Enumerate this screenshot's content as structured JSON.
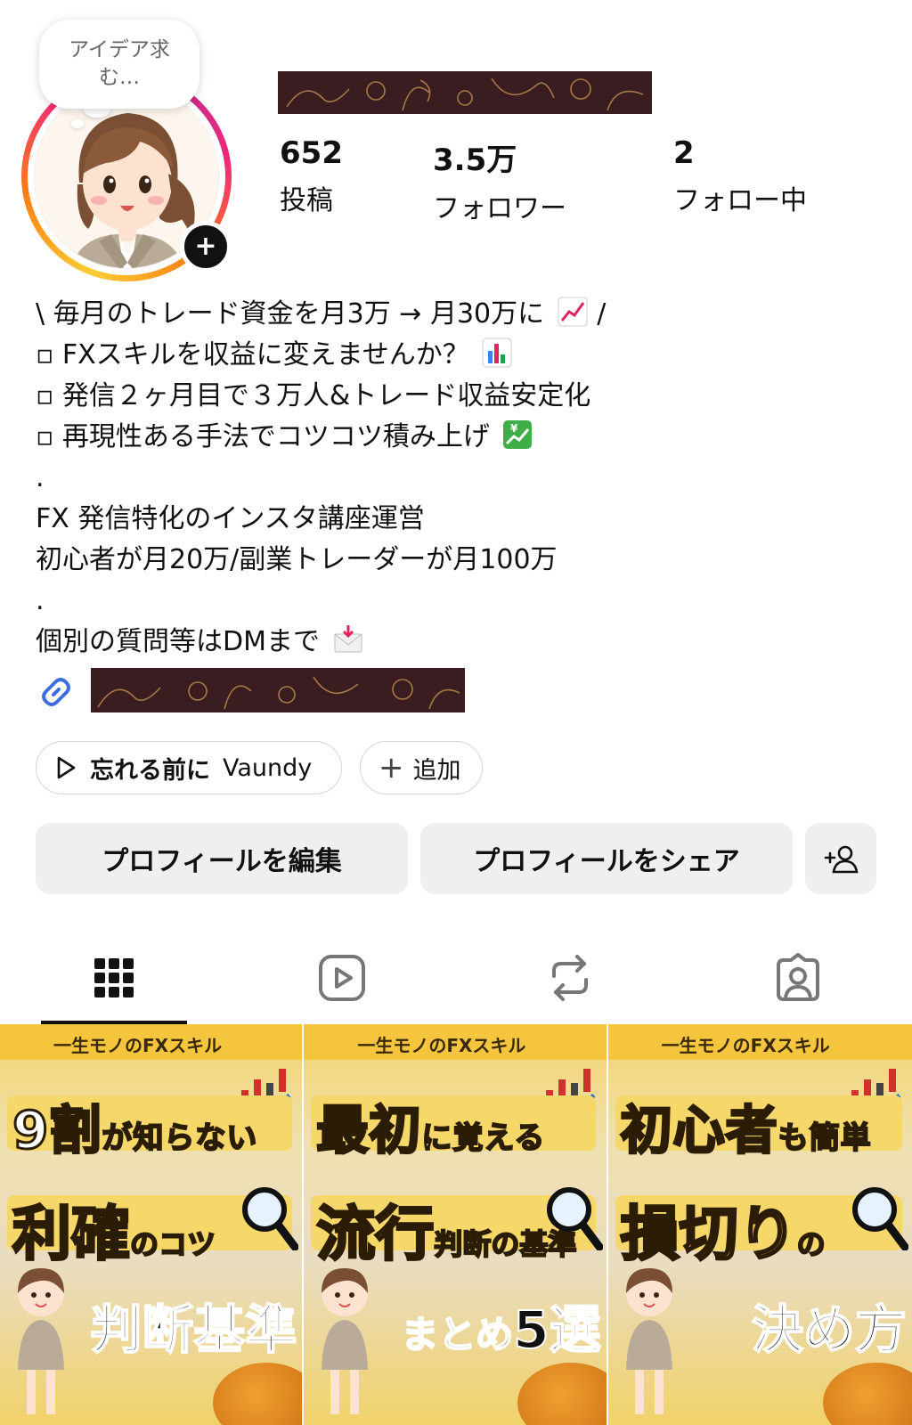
{
  "profile": {
    "note_text": "アイデア求む…",
    "avatar_icon": "illustrated-woman-avatar",
    "add_story_icon": "plus-icon",
    "username_redacted": true
  },
  "stats": [
    {
      "value": "652",
      "label": "投稿"
    },
    {
      "value": "3.5万",
      "label": "フォロワー"
    },
    {
      "value": "2",
      "label": "フォロー中"
    }
  ],
  "bio": {
    "lines": [
      "\\ 毎月のトレード資金を月3万 → 月30万に",
      "▫︎ FXスキルを収益に変えませんか？",
      "▫︎ 発信２ヶ月目で３万人&トレード収益安定化",
      "▫︎ 再現性ある手法でコツコツ積み上げ",
      ".",
      "FX 発信特化のインスタ講座運営",
      "初心者が月20万/副業トレーダーが月100万",
      ".",
      "個別の質問等はDMまで"
    ],
    "line1_suffix": " /",
    "emojis": [
      "chart-increasing-emoji",
      "bar-chart-emoji",
      "chart-yen-emoji",
      "envelope-arrow-emoji"
    ]
  },
  "link": {
    "icon": "link-icon",
    "redacted": true
  },
  "music": {
    "icon": "play-icon",
    "title": "忘れる前に",
    "artist": "Vaundy"
  },
  "add_pill": {
    "icon": "plus-icon",
    "label": "追加"
  },
  "buttons": {
    "edit": "プロフィールを編集",
    "share": "プロフィールをシェア",
    "add_person_icon": "add-person-icon"
  },
  "tabs": [
    {
      "name": "grid",
      "icon": "grid-icon",
      "active": true
    },
    {
      "name": "reels",
      "icon": "reels-icon",
      "active": false
    },
    {
      "name": "reposts",
      "icon": "repost-icon",
      "active": false
    },
    {
      "name": "tagged",
      "icon": "tagged-person-icon",
      "active": false
    }
  ],
  "posts": [
    {
      "series": "一生モノのFXスキル",
      "line1_big": "9割",
      "line1_small": "が知らない",
      "line2_big": "利確",
      "line2_small": "のコツ",
      "line3_mid": "",
      "line3_big": "判断基準"
    },
    {
      "series": "一生モノのFXスキル",
      "line1_big": "最初",
      "line1_small": "に覚える",
      "line2_big": "流行",
      "line2_small": "判断の基準",
      "line3_mid": "まとめ",
      "line3_big": "5選"
    },
    {
      "series": "一生モノのFXスキル",
      "line1_big": "初心者",
      "line1_small": "も簡単",
      "line2_big": "損切り",
      "line2_small": "の",
      "line3_mid": "",
      "line3_big": "決め方"
    }
  ],
  "colors": {
    "ring_start": "#f9ce34",
    "ring_mid": "#ee2a7b",
    "link_blue": "#3b6de0",
    "redaction": "#3a1d20",
    "button_bg": "#efeff1",
    "post_yellow": "#f4c53d"
  }
}
